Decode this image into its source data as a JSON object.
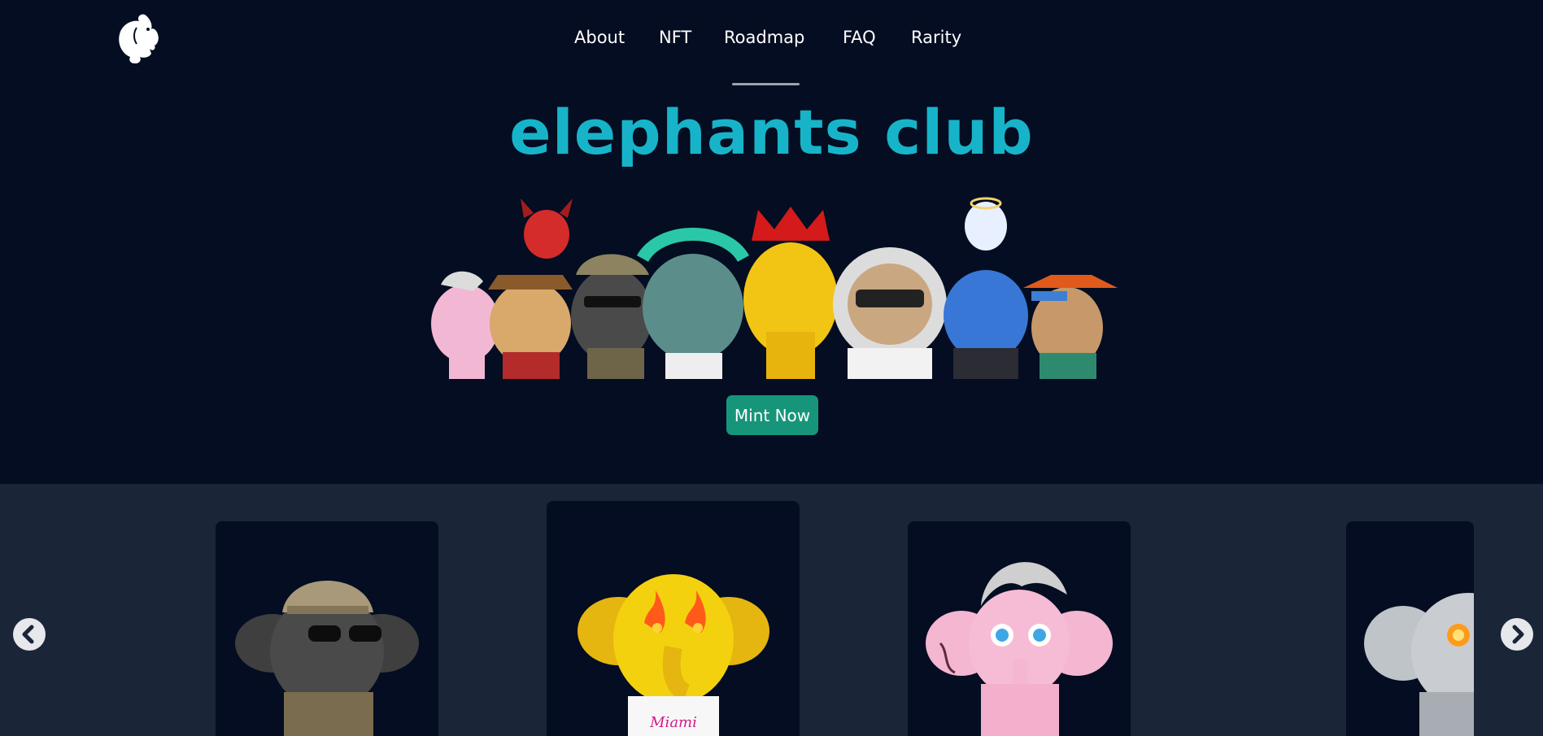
{
  "nav": {
    "items": [
      {
        "label": "About"
      },
      {
        "label": "NFT"
      },
      {
        "label": "Roadmap"
      },
      {
        "label": "FAQ"
      },
      {
        "label": "Rarity"
      }
    ]
  },
  "hero": {
    "title": "elephants club",
    "cta_label": "Mint Now"
  },
  "icons": {
    "logo": "elephant-logo-icon",
    "prev": "chevron-left-icon",
    "next": "chevron-right-icon"
  },
  "colors": {
    "background": "#040d21",
    "gallery_band": "#1b2538",
    "title": "#17b4c9",
    "button": "#17957a"
  }
}
